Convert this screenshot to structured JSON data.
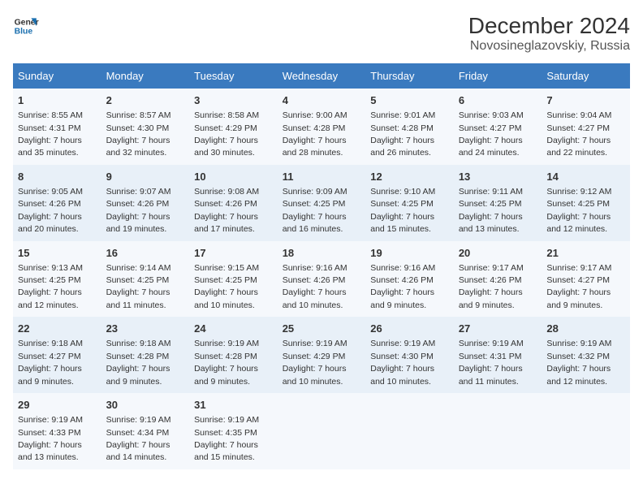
{
  "logo": {
    "line1": "General",
    "line2": "Blue"
  },
  "title": "December 2024",
  "subtitle": "Novosineglazovskiy, Russia",
  "days_header": [
    "Sunday",
    "Monday",
    "Tuesday",
    "Wednesday",
    "Thursday",
    "Friday",
    "Saturday"
  ],
  "weeks": [
    [
      {
        "day": "1",
        "sunrise": "Sunrise: 8:55 AM",
        "sunset": "Sunset: 4:31 PM",
        "daylight": "Daylight: 7 hours and 35 minutes."
      },
      {
        "day": "2",
        "sunrise": "Sunrise: 8:57 AM",
        "sunset": "Sunset: 4:30 PM",
        "daylight": "Daylight: 7 hours and 32 minutes."
      },
      {
        "day": "3",
        "sunrise": "Sunrise: 8:58 AM",
        "sunset": "Sunset: 4:29 PM",
        "daylight": "Daylight: 7 hours and 30 minutes."
      },
      {
        "day": "4",
        "sunrise": "Sunrise: 9:00 AM",
        "sunset": "Sunset: 4:28 PM",
        "daylight": "Daylight: 7 hours and 28 minutes."
      },
      {
        "day": "5",
        "sunrise": "Sunrise: 9:01 AM",
        "sunset": "Sunset: 4:28 PM",
        "daylight": "Daylight: 7 hours and 26 minutes."
      },
      {
        "day": "6",
        "sunrise": "Sunrise: 9:03 AM",
        "sunset": "Sunset: 4:27 PM",
        "daylight": "Daylight: 7 hours and 24 minutes."
      },
      {
        "day": "7",
        "sunrise": "Sunrise: 9:04 AM",
        "sunset": "Sunset: 4:27 PM",
        "daylight": "Daylight: 7 hours and 22 minutes."
      }
    ],
    [
      {
        "day": "8",
        "sunrise": "Sunrise: 9:05 AM",
        "sunset": "Sunset: 4:26 PM",
        "daylight": "Daylight: 7 hours and 20 minutes."
      },
      {
        "day": "9",
        "sunrise": "Sunrise: 9:07 AM",
        "sunset": "Sunset: 4:26 PM",
        "daylight": "Daylight: 7 hours and 19 minutes."
      },
      {
        "day": "10",
        "sunrise": "Sunrise: 9:08 AM",
        "sunset": "Sunset: 4:26 PM",
        "daylight": "Daylight: 7 hours and 17 minutes."
      },
      {
        "day": "11",
        "sunrise": "Sunrise: 9:09 AM",
        "sunset": "Sunset: 4:25 PM",
        "daylight": "Daylight: 7 hours and 16 minutes."
      },
      {
        "day": "12",
        "sunrise": "Sunrise: 9:10 AM",
        "sunset": "Sunset: 4:25 PM",
        "daylight": "Daylight: 7 hours and 15 minutes."
      },
      {
        "day": "13",
        "sunrise": "Sunrise: 9:11 AM",
        "sunset": "Sunset: 4:25 PM",
        "daylight": "Daylight: 7 hours and 13 minutes."
      },
      {
        "day": "14",
        "sunrise": "Sunrise: 9:12 AM",
        "sunset": "Sunset: 4:25 PM",
        "daylight": "Daylight: 7 hours and 12 minutes."
      }
    ],
    [
      {
        "day": "15",
        "sunrise": "Sunrise: 9:13 AM",
        "sunset": "Sunset: 4:25 PM",
        "daylight": "Daylight: 7 hours and 12 minutes."
      },
      {
        "day": "16",
        "sunrise": "Sunrise: 9:14 AM",
        "sunset": "Sunset: 4:25 PM",
        "daylight": "Daylight: 7 hours and 11 minutes."
      },
      {
        "day": "17",
        "sunrise": "Sunrise: 9:15 AM",
        "sunset": "Sunset: 4:25 PM",
        "daylight": "Daylight: 7 hours and 10 minutes."
      },
      {
        "day": "18",
        "sunrise": "Sunrise: 9:16 AM",
        "sunset": "Sunset: 4:26 PM",
        "daylight": "Daylight: 7 hours and 10 minutes."
      },
      {
        "day": "19",
        "sunrise": "Sunrise: 9:16 AM",
        "sunset": "Sunset: 4:26 PM",
        "daylight": "Daylight: 7 hours and 9 minutes."
      },
      {
        "day": "20",
        "sunrise": "Sunrise: 9:17 AM",
        "sunset": "Sunset: 4:26 PM",
        "daylight": "Daylight: 7 hours and 9 minutes."
      },
      {
        "day": "21",
        "sunrise": "Sunrise: 9:17 AM",
        "sunset": "Sunset: 4:27 PM",
        "daylight": "Daylight: 7 hours and 9 minutes."
      }
    ],
    [
      {
        "day": "22",
        "sunrise": "Sunrise: 9:18 AM",
        "sunset": "Sunset: 4:27 PM",
        "daylight": "Daylight: 7 hours and 9 minutes."
      },
      {
        "day": "23",
        "sunrise": "Sunrise: 9:18 AM",
        "sunset": "Sunset: 4:28 PM",
        "daylight": "Daylight: 7 hours and 9 minutes."
      },
      {
        "day": "24",
        "sunrise": "Sunrise: 9:19 AM",
        "sunset": "Sunset: 4:28 PM",
        "daylight": "Daylight: 7 hours and 9 minutes."
      },
      {
        "day": "25",
        "sunrise": "Sunrise: 9:19 AM",
        "sunset": "Sunset: 4:29 PM",
        "daylight": "Daylight: 7 hours and 10 minutes."
      },
      {
        "day": "26",
        "sunrise": "Sunrise: 9:19 AM",
        "sunset": "Sunset: 4:30 PM",
        "daylight": "Daylight: 7 hours and 10 minutes."
      },
      {
        "day": "27",
        "sunrise": "Sunrise: 9:19 AM",
        "sunset": "Sunset: 4:31 PM",
        "daylight": "Daylight: 7 hours and 11 minutes."
      },
      {
        "day": "28",
        "sunrise": "Sunrise: 9:19 AM",
        "sunset": "Sunset: 4:32 PM",
        "daylight": "Daylight: 7 hours and 12 minutes."
      }
    ],
    [
      {
        "day": "29",
        "sunrise": "Sunrise: 9:19 AM",
        "sunset": "Sunset: 4:33 PM",
        "daylight": "Daylight: 7 hours and 13 minutes."
      },
      {
        "day": "30",
        "sunrise": "Sunrise: 9:19 AM",
        "sunset": "Sunset: 4:34 PM",
        "daylight": "Daylight: 7 hours and 14 minutes."
      },
      {
        "day": "31",
        "sunrise": "Sunrise: 9:19 AM",
        "sunset": "Sunset: 4:35 PM",
        "daylight": "Daylight: 7 hours and 15 minutes."
      },
      null,
      null,
      null,
      null
    ]
  ]
}
